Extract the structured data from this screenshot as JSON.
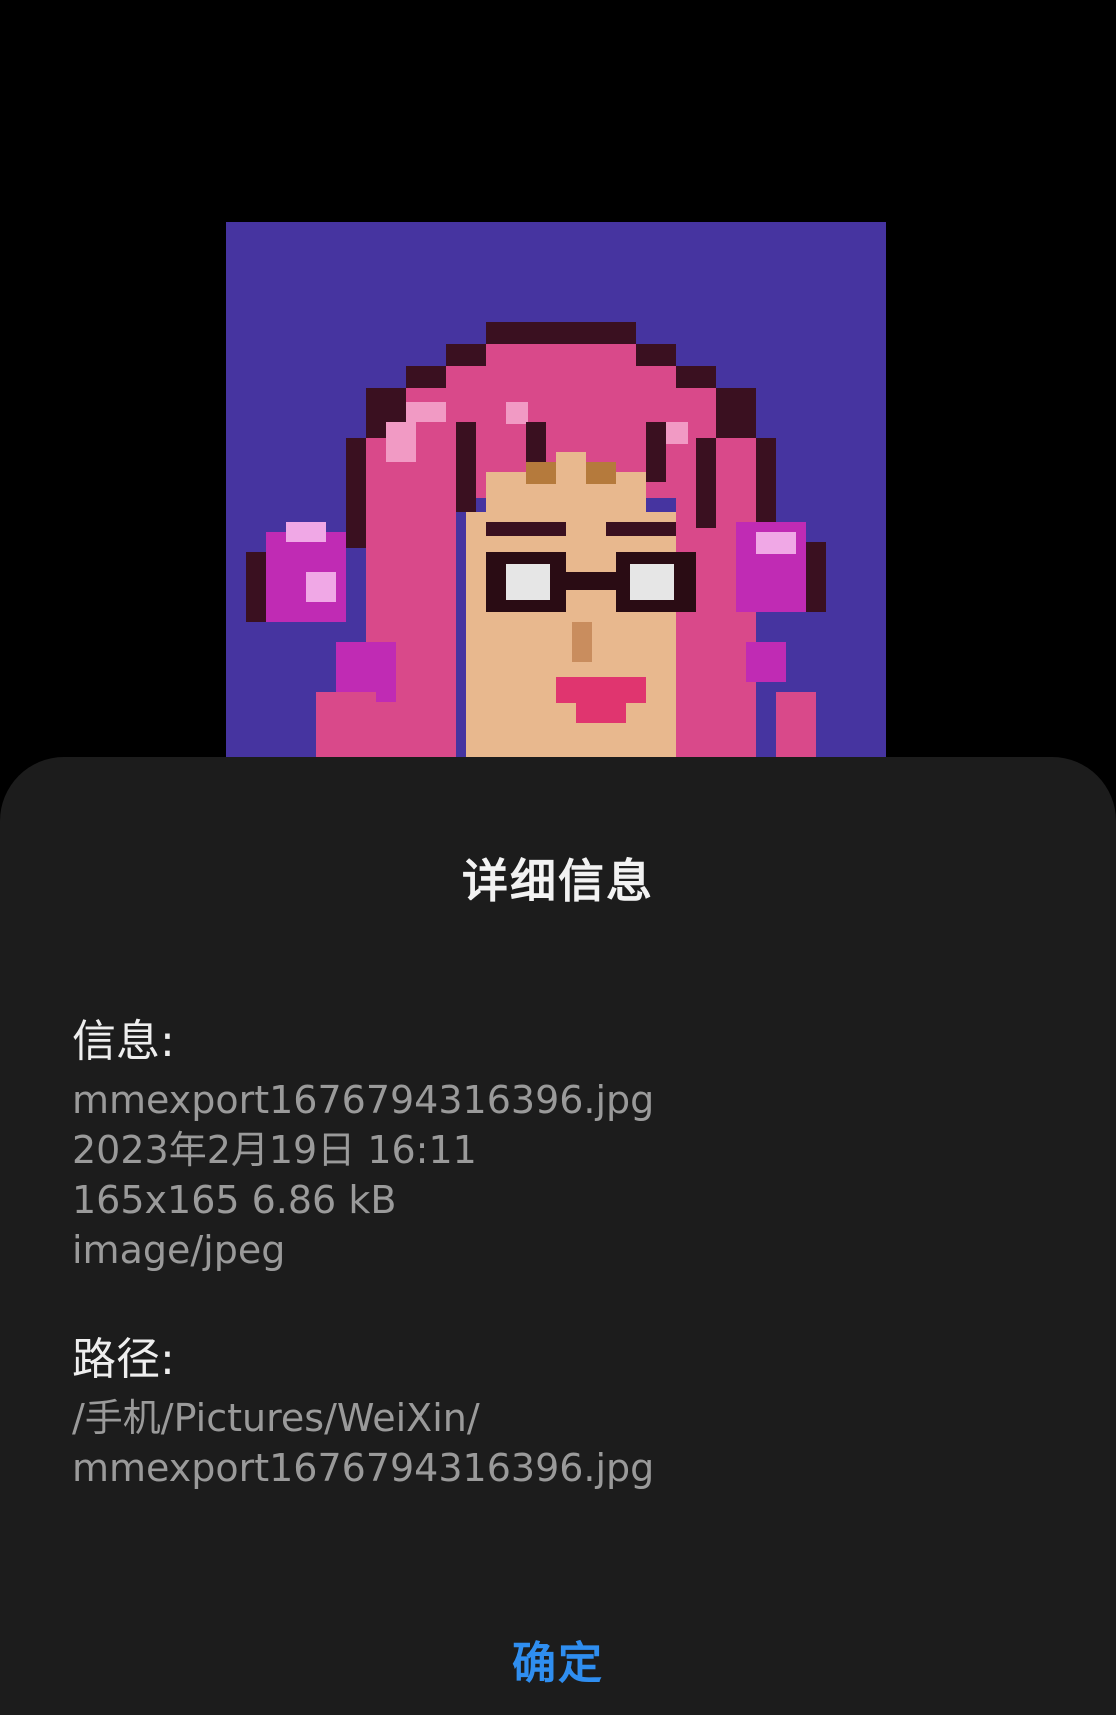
{
  "dialog": {
    "title": "详细信息",
    "info": {
      "heading": "信息:",
      "lines": [
        "mmexport1676794316396.jpg",
        "2023年2月19日   16:11",
        "165x165  6.86 kB",
        "image/jpeg"
      ]
    },
    "path": {
      "heading": "路径:",
      "lines": [
        "/手机/Pictures/WeiXin/",
        "mmexport1676794316396.jpg"
      ]
    },
    "confirm_label": "确定"
  },
  "colors": {
    "background": "#000000",
    "sheet": "#1c1c1c",
    "accent": "#2f8ef0",
    "photo_bg": "#4634a0"
  }
}
